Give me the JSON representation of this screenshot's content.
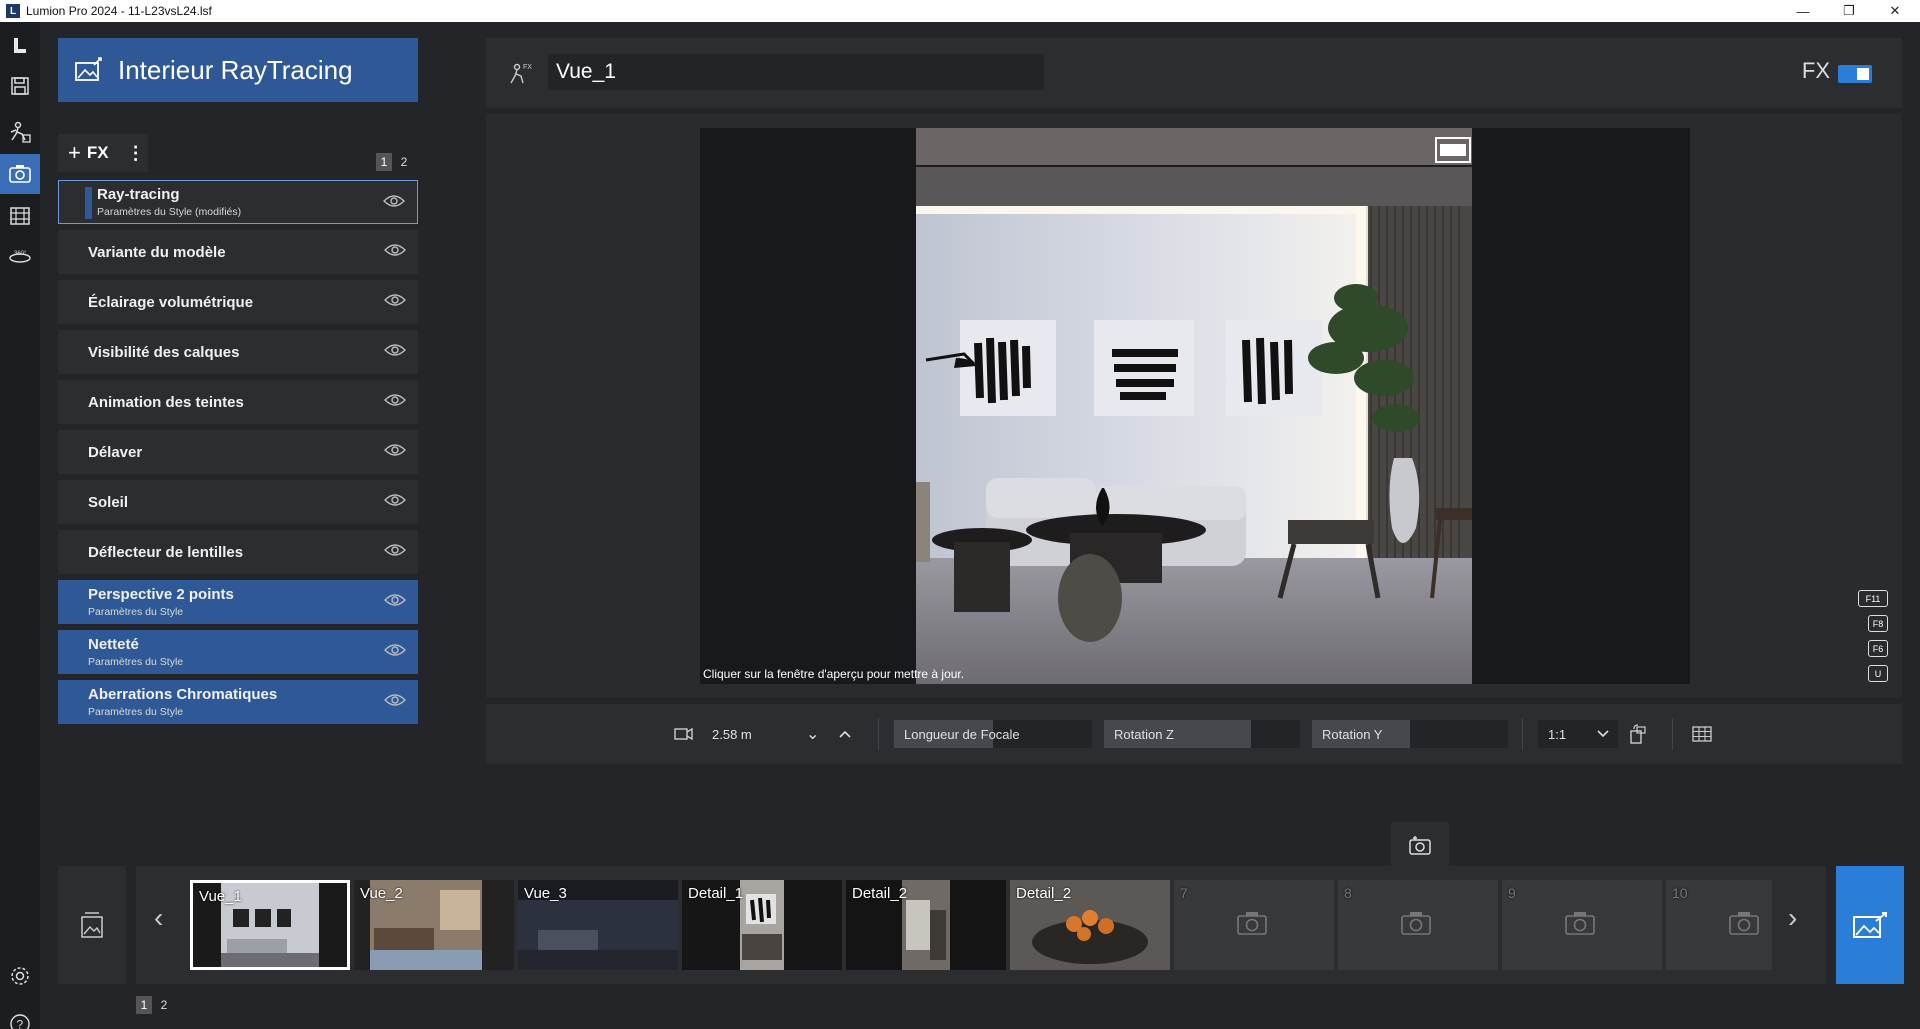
{
  "window": {
    "title": "Lumion Pro 2024 - 11-L23vsL24.lsf",
    "logo_letter": "L",
    "minimize": "—",
    "maximize": "❐",
    "close": "✕"
  },
  "sidebar_icons": [
    "lumion-logo-icon",
    "save-icon",
    "build-mode-icon",
    "photo-mode-icon",
    "movie-mode-icon",
    "panorama-360-icon",
    "settings-icon",
    "help-icon"
  ],
  "project": {
    "title": "Interieur RayTracing"
  },
  "fx_panel": {
    "add_label": "FX",
    "plus": "+",
    "more": "⋮",
    "pages": [
      "1",
      "2"
    ],
    "effects": [
      {
        "name": "Ray-tracing",
        "subtitle": "Paramètres du Style (modifiés)"
      },
      {
        "name": "Variante du modèle",
        "subtitle": ""
      },
      {
        "name": "Éclairage volumétrique",
        "subtitle": ""
      },
      {
        "name": "Visibilité des calques",
        "subtitle": ""
      },
      {
        "name": "Animation des teintes",
        "subtitle": ""
      },
      {
        "name": "Délaver",
        "subtitle": ""
      },
      {
        "name": "Soleil",
        "subtitle": ""
      },
      {
        "name": "Déflecteur de lentilles",
        "subtitle": ""
      },
      {
        "name": "Perspective 2 points",
        "subtitle": "Paramètres du Style"
      },
      {
        "name": "Netteté",
        "subtitle": "Paramètres du Style"
      },
      {
        "name": "Aberrations Chromatiques",
        "subtitle": "Paramètres du Style"
      }
    ]
  },
  "view": {
    "name": "Vue_1",
    "fx_label": "FX",
    "fx_enabled": true,
    "preview_hint": "Cliquer sur la fenêtre d'aperçu pour mettre à jour.",
    "shortcut_keys": [
      "F11",
      "F8",
      "F6",
      "U"
    ]
  },
  "camera": {
    "height_value": "2.58 m",
    "focal_label": "Longueur de Focale",
    "focal_fraction": 0.5,
    "rotation_z_label": "Rotation Z",
    "rotation_z_fraction": 0.75,
    "rotation_y_label": "Rotation Y",
    "rotation_y_fraction": 0.5,
    "aspect_value": "1:1"
  },
  "thumbnails": [
    {
      "label": "Vue_1",
      "has_image": true,
      "active": true
    },
    {
      "label": "Vue_2",
      "has_image": true,
      "active": false
    },
    {
      "label": "Vue_3",
      "has_image": true,
      "active": false
    },
    {
      "label": "Detail_1",
      "has_image": true,
      "active": false
    },
    {
      "label": "Detail_2",
      "has_image": true,
      "active": false
    },
    {
      "label": "Detail_2",
      "has_image": true,
      "active": false
    },
    {
      "label": "7",
      "has_image": false,
      "active": false
    },
    {
      "label": "8",
      "has_image": false,
      "active": false
    },
    {
      "label": "9",
      "has_image": false,
      "active": false
    },
    {
      "label": "10",
      "has_image": false,
      "active": false
    }
  ],
  "thumb_pages": [
    "1",
    "2"
  ],
  "colors": {
    "accent_blue": "#2f5996",
    "toggle_blue": "#2a7ed8",
    "panel": "#2b2d31",
    "background": "#232529"
  }
}
